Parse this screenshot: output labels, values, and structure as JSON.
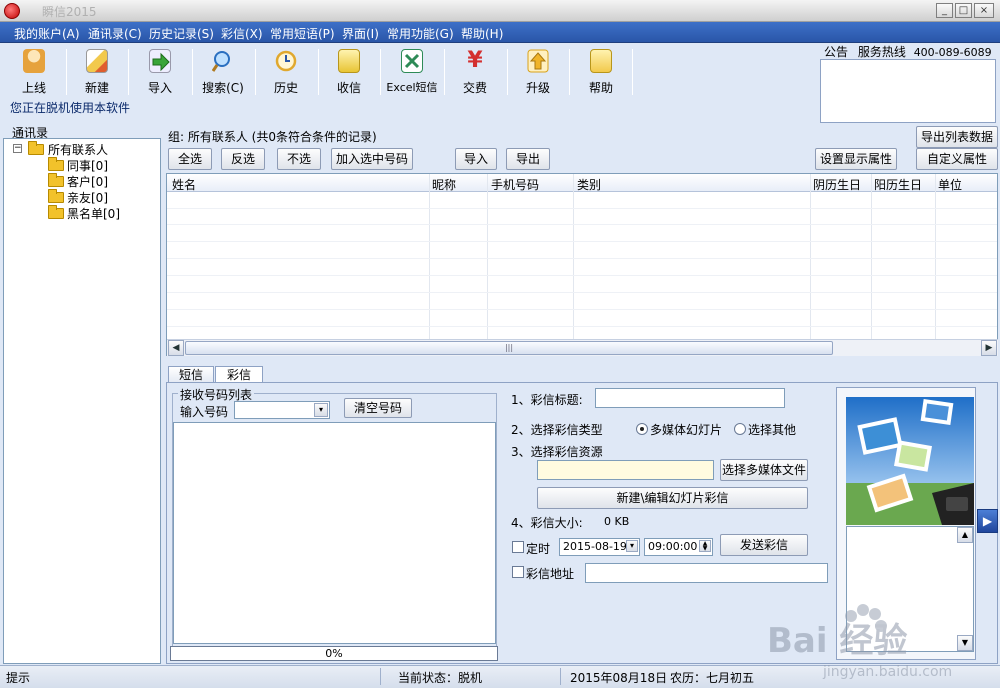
{
  "window": {
    "title": "瞬信2015",
    "controls": [
      "_",
      "□",
      "×",
      "▣"
    ]
  },
  "menu": [
    "我的账户(A)",
    "通讯录(C)",
    "历史记录(S)",
    "彩信(X)",
    "常用短语(P)",
    "界面(I)",
    "常用功能(G)",
    "帮助(H)"
  ],
  "toolbar": {
    "buttons": [
      {
        "label": "上线",
        "icon": "user-online-icon",
        "color": "#e6a23c"
      },
      {
        "label": "新建",
        "icon": "pencil-icon",
        "color": "#f2c94c"
      },
      {
        "label": "导入",
        "icon": "arrow-import-icon",
        "color": "#3aa53a"
      },
      {
        "label": "搜索(C)",
        "icon": "magnifier-icon",
        "color": "#4a90d9"
      },
      {
        "label": "历史",
        "icon": "clock-icon",
        "color": "#e0a82e"
      },
      {
        "label": "收信",
        "icon": "inbox-icon",
        "color": "#e8c535"
      },
      {
        "label": "Excel短信",
        "icon": "excel-icon",
        "color": "#2e8b57"
      },
      {
        "label": "交费",
        "icon": "yuan-icon",
        "color": "#d32f2f"
      },
      {
        "label": "升级",
        "icon": "upgrade-icon",
        "color": "#f0b429"
      },
      {
        "label": "帮助",
        "icon": "help-icon",
        "color": "#f2c94c"
      }
    ],
    "offline_notice": "您正在脱机使用本软件"
  },
  "notice": {
    "label": "公告",
    "hotline_label": "服务热线",
    "hotline": "400-089-6089"
  },
  "contacts": {
    "title": "通讯录",
    "root": {
      "label": "所有联系人"
    },
    "groups": [
      "同事[0]",
      "客户[0]",
      "亲友[0]",
      "黑名单[0]"
    ]
  },
  "list": {
    "group_info": "组: 所有联系人 (共0条符合条件的记录)",
    "buttons": {
      "select_all": "全选",
      "invert": "反选",
      "select_none": "不选",
      "add_selected": "加入选中号码",
      "import": "导入",
      "export": "导出",
      "export_list": "导出列表数据",
      "display_props": "设置显示属性",
      "custom_props": "自定义属性"
    },
    "columns": [
      "姓名",
      "昵称",
      "手机号码",
      "类别",
      "阴历生日",
      "阳历生日",
      "单位"
    ]
  },
  "tabs": [
    "短信",
    "彩信"
  ],
  "recipients": {
    "title": "接收号码列表",
    "input_label": "输入号码",
    "input_value": "",
    "clear_button": "清空号码",
    "progress": 0,
    "progress_text": "0%"
  },
  "mms": {
    "title_label": "1、彩信标题:",
    "title_value": "",
    "type_label": "2、选择彩信类型",
    "type_options": [
      "多媒体幻灯片",
      "选择其他"
    ],
    "type_selected": "多媒体幻灯片",
    "resource_label": "3、选择彩信资源",
    "resource_value": "",
    "choose_file_button": "选择多媒体文件",
    "edit_slides_button": "新建\\编辑幻灯片彩信",
    "size_label": "4、彩信大小:",
    "size_value": "0 KB",
    "timer_label": "定时",
    "date_value": "2015-08-19",
    "time_value": "09:00:00",
    "send_button": "发送彩信",
    "address_label": "彩信地址",
    "address_value": ""
  },
  "status": {
    "hint": "提示",
    "state": "当前状态：脱机",
    "date": "2015年08月18日",
    "lunar": "农历：七月初五"
  },
  "watermark": {
    "text": "Bai 经验",
    "url": "jingyan.baidu.com"
  },
  "colors": {
    "menubar": "#2f5fb8",
    "panel": "#dfe8f6",
    "accent_blue": "#2a56a8"
  }
}
